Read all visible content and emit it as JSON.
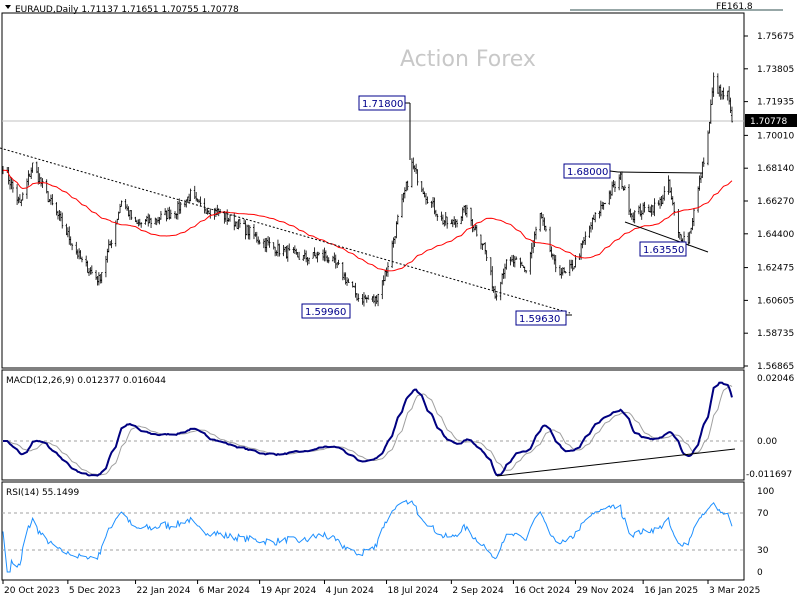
{
  "header": {
    "symbol_line": "EURAUD,Daily  1.71137 1.71651 1.70755 1.70778",
    "fibo_label": "FE161.8"
  },
  "watermark": "Action Forex",
  "current_price": "1.70778",
  "annotations": {
    "high_jul": "1.71800",
    "low_jun": "1.59960",
    "low_sep": "1.59630",
    "high_nov": "1.68000",
    "low_jan": "1.63550"
  },
  "colors": {
    "ma": "#ff0000",
    "macd": "#000080",
    "signal": "#a0a0a0",
    "rsi": "#1e90ff",
    "bars": "#000000"
  },
  "chart_data": [
    {
      "type": "ohlc",
      "title": "EURAUD,Daily",
      "ylim": [
        1.56865,
        1.75675
      ],
      "yticks": [
        "1.75675",
        "1.73805",
        "1.71935",
        "1.70010",
        "1.68140",
        "1.66270",
        "1.64400",
        "1.62475",
        "1.60605",
        "1.58735",
        "1.56865"
      ],
      "xticks": [
        "20 Oct 2023",
        "5 Dec 2023",
        "22 Jan 2024",
        "6 Mar 2024",
        "19 Apr 2024",
        "4 Jun 2024",
        "18 Jul 2024",
        "2 Sep 2024",
        "16 Oct 2024",
        "29 Nov 2024",
        "16 Jan 2025",
        "3 Mar 2025"
      ],
      "xtick_dates": [
        "2023-10-20",
        "2023-12-05",
        "2024-01-22",
        "2024-03-06",
        "2024-04-19",
        "2024-06-04",
        "2024-07-18",
        "2024-09-02",
        "2024-10-16",
        "2024-11-29",
        "2025-01-16",
        "2025-03-03"
      ],
      "last": {
        "open": 1.71137,
        "high": 1.71651,
        "low": 1.70755,
        "close": 1.70778
      },
      "close_points": [
        [
          "2023-10-20",
          1.6832
        ],
        [
          "2023-11-01",
          1.6604
        ],
        [
          "2023-11-10",
          1.6832
        ],
        [
          "2023-11-20",
          1.6661
        ],
        [
          "2023-12-05",
          1.6433
        ],
        [
          "2023-12-15",
          1.6279
        ],
        [
          "2023-12-27",
          1.6177
        ],
        [
          "2024-01-05",
          1.6405
        ],
        [
          "2024-01-12",
          1.6633
        ],
        [
          "2024-01-22",
          1.649
        ],
        [
          "2024-02-05",
          1.6519
        ],
        [
          "2024-02-20",
          1.6576
        ],
        [
          "2024-03-01",
          1.6661
        ],
        [
          "2024-03-06",
          1.6604
        ],
        [
          "2024-03-20",
          1.6564
        ],
        [
          "2024-04-05",
          1.649
        ],
        [
          "2024-04-19",
          1.6405
        ],
        [
          "2024-05-03",
          1.6348
        ],
        [
          "2024-05-20",
          1.6302
        ],
        [
          "2024-06-04",
          1.6319
        ],
        [
          "2024-06-14",
          1.6245
        ],
        [
          "2024-06-28",
          1.6074
        ],
        [
          "2024-07-10",
          1.6063
        ],
        [
          "2024-07-18",
          1.6234
        ],
        [
          "2024-07-26",
          1.6519
        ],
        [
          "2024-08-05",
          1.6832
        ],
        [
          "2024-08-15",
          1.6661
        ],
        [
          "2024-08-26",
          1.6519
        ],
        [
          "2024-09-02",
          1.649
        ],
        [
          "2024-09-12",
          1.6576
        ],
        [
          "2024-09-25",
          1.6376
        ],
        [
          "2024-10-03",
          1.6091
        ],
        [
          "2024-10-10",
          1.6262
        ],
        [
          "2024-10-16",
          1.6279
        ],
        [
          "2024-10-25",
          1.6234
        ],
        [
          "2024-11-04",
          1.6547
        ],
        [
          "2024-11-14",
          1.6262
        ],
        [
          "2024-11-22",
          1.6205
        ],
        [
          "2024-11-29",
          1.6279
        ],
        [
          "2024-12-10",
          1.649
        ],
        [
          "2024-12-20",
          1.6633
        ],
        [
          "2024-12-31",
          1.6758
        ],
        [
          "2025-01-08",
          1.6547
        ],
        [
          "2025-01-16",
          1.6576
        ],
        [
          "2025-01-27",
          1.6604
        ],
        [
          "2025-02-03",
          1.6718
        ],
        [
          "2025-02-10",
          1.6433
        ],
        [
          "2025-02-17",
          1.6405
        ],
        [
          "2025-02-24",
          1.669
        ],
        [
          "2025-03-03",
          1.7003
        ],
        [
          "2025-03-07",
          1.7317
        ],
        [
          "2025-03-12",
          1.7231
        ],
        [
          "2025-03-17",
          1.7231
        ],
        [
          "2025-03-20",
          1.70778
        ]
      ]
    },
    {
      "type": "line",
      "title": "MACD(12,26,9) 0.012377 0.016044",
      "yticks": [
        "0.02046",
        "0.00",
        "-0.011697"
      ],
      "ylim": [
        -0.011697,
        0.02046
      ]
    },
    {
      "type": "line",
      "title": "RSI(14) 55.1499",
      "yticks": [
        "100",
        "70",
        "30",
        "0"
      ],
      "ylim": [
        0,
        100
      ],
      "levels": [
        70,
        30
      ]
    }
  ]
}
